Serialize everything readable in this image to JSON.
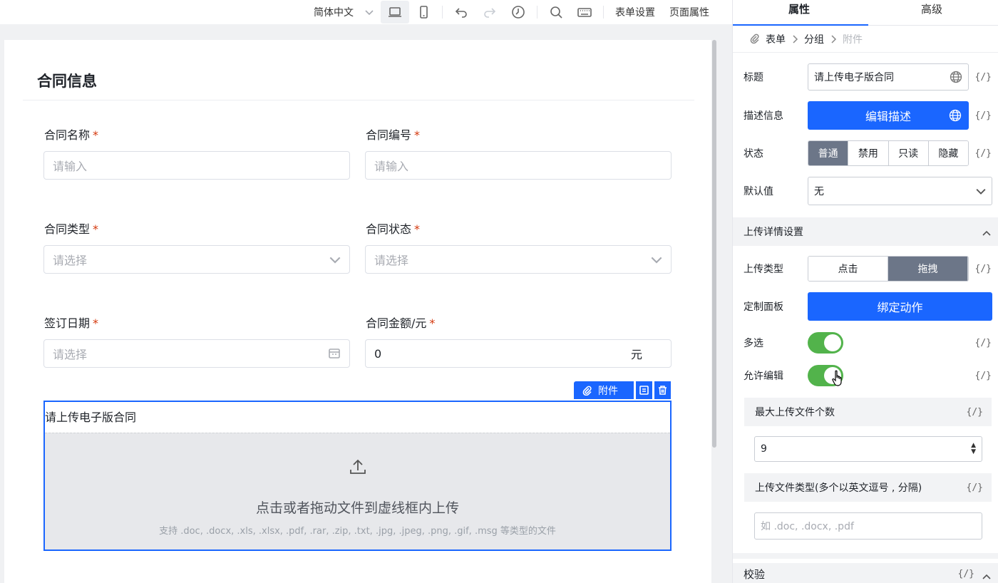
{
  "toolbar": {
    "language": "简体中文",
    "form_settings": "表单设置",
    "page_props": "页面属性",
    "icons": [
      "desktop-icon",
      "mobile-icon",
      "undo-icon",
      "redo-icon",
      "history-icon",
      "search-icon",
      "keyboard-icon"
    ]
  },
  "form": {
    "title": "合同信息",
    "fields": [
      {
        "label": "合同名称",
        "placeholder": "请输入",
        "type": "input"
      },
      {
        "label": "合同编号",
        "placeholder": "请输入",
        "type": "input"
      },
      {
        "label": "合同类型",
        "placeholder": "请选择",
        "type": "select"
      },
      {
        "label": "合同状态",
        "placeholder": "请选择",
        "type": "select"
      },
      {
        "label": "签订日期",
        "placeholder": "请选择",
        "type": "date"
      },
      {
        "label": "合同金额/元",
        "value": "0",
        "suffix": "元",
        "type": "number"
      }
    ],
    "required_mark": "*",
    "upload": {
      "tag": "附件",
      "title": "请上传电子版合同",
      "main_text": "点击或者拖动文件到虚线框内上传",
      "sub_text": "支持 .doc, .docx, .xls, .xlsx, .pdf, .rar, .zip, .txt, .jpg, .jpeg, .png, .gif, .msg 等类型的文件"
    }
  },
  "panel": {
    "tabs": [
      "属性",
      "高级"
    ],
    "breadcrumb": [
      "表单",
      "分组",
      "附件"
    ],
    "fx": "{/}",
    "props": {
      "title_label": "标题",
      "title_value": "请上传电子版合同",
      "desc_label": "描述信息",
      "desc_button": "编辑描述",
      "status_label": "状态",
      "status_options": [
        "普通",
        "禁用",
        "只读",
        "隐藏"
      ],
      "status_selected": "普通",
      "default_label": "默认值",
      "default_value": "无"
    },
    "upload_section": {
      "header": "上传详情设置",
      "type_label": "上传类型",
      "type_options": [
        "点击",
        "拖拽"
      ],
      "type_selected": "拖拽",
      "panel_label": "定制面板",
      "panel_button": "绑定动作",
      "multi_label": "多选",
      "multi_on": true,
      "edit_label": "允许编辑",
      "edit_on": true,
      "max_files_header": "最大上传文件个数",
      "max_files_value": "9",
      "file_types_header": "上传文件类型(多个以英文逗号 , 分隔)",
      "file_types_placeholder": "如 .doc, .docx, .pdf"
    },
    "validate_header": "校验"
  }
}
